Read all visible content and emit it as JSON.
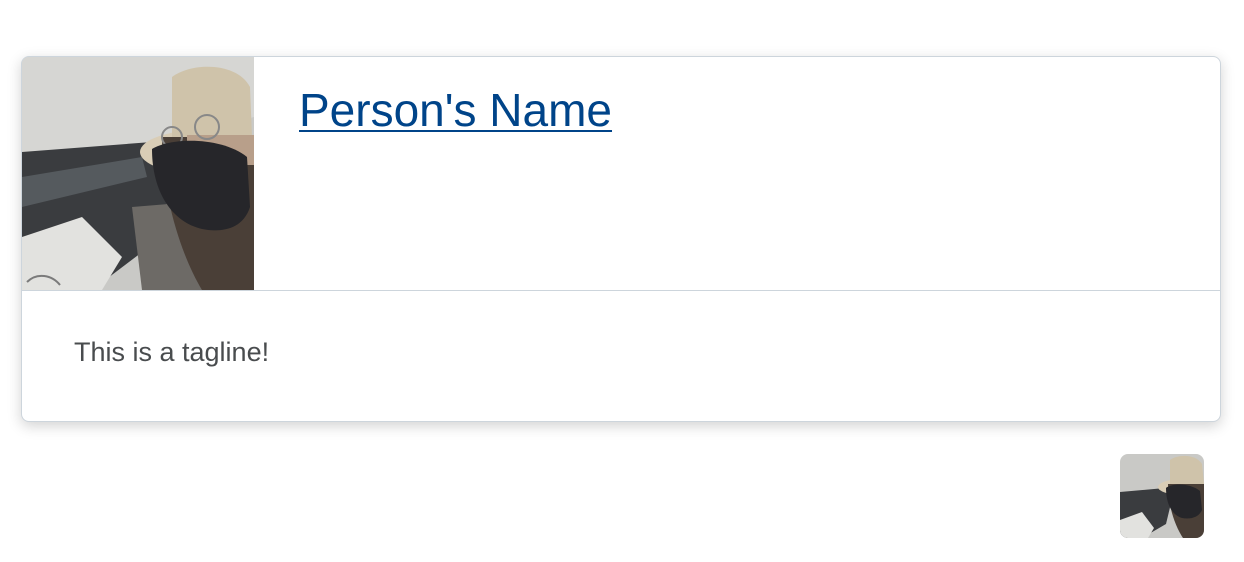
{
  "profile_card": {
    "name": "Person's Name",
    "tagline": "This is a tagline!",
    "photo_icon": "profile-photo",
    "colors": {
      "link": "#004489",
      "tagline": "#494c4e",
      "border": "#cdd5dc"
    }
  },
  "avatar": {
    "icon": "profile-avatar"
  }
}
